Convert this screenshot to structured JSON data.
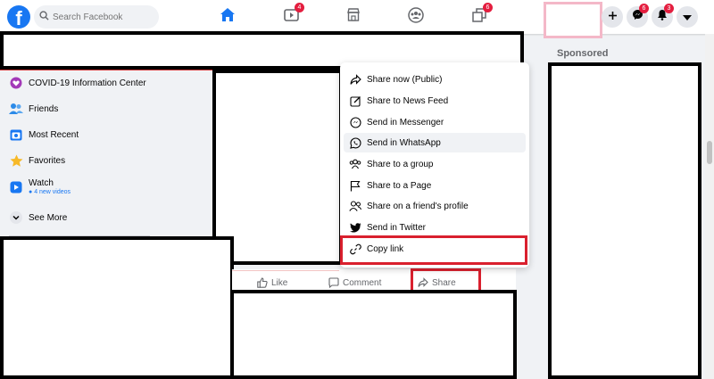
{
  "header": {
    "logo_letter": "f",
    "search_placeholder": "Search Facebook",
    "badges": {
      "watch": "4",
      "groups": "6",
      "messenger": "6",
      "notifications": "3"
    },
    "accent_color": "#1877f2",
    "badge_color": "#e41e3f"
  },
  "sidebar": {
    "items": [
      {
        "label": "COVID-19 Information Center",
        "icon": "covid-heart-icon"
      },
      {
        "label": "Friends",
        "icon": "friends-icon"
      },
      {
        "label": "Most Recent",
        "icon": "most-recent-icon"
      },
      {
        "label": "Favorites",
        "icon": "star-icon"
      },
      {
        "label": "Watch",
        "sub": "4 new videos",
        "icon": "watch-icon"
      },
      {
        "label": "See More",
        "icon": "chevron-down-icon"
      }
    ]
  },
  "share_menu": {
    "items": [
      {
        "label": "Share now (Public)",
        "icon": "share-arrow-icon"
      },
      {
        "label": "Share to News Feed",
        "icon": "edit-icon"
      },
      {
        "label": "Send in Messenger",
        "icon": "messenger-icon"
      },
      {
        "label": "Send in WhatsApp",
        "icon": "whatsapp-icon"
      },
      {
        "label": "Share to a group",
        "icon": "group-icon"
      },
      {
        "label": "Share to a Page",
        "icon": "flag-icon"
      },
      {
        "label": "Share on a friend's profile",
        "icon": "friend-profile-icon"
      },
      {
        "label": "Send in Twitter",
        "icon": "twitter-icon"
      },
      {
        "label": "Copy link",
        "icon": "link-icon"
      }
    ]
  },
  "post_actions": {
    "like": "Like",
    "comment": "Comment",
    "share": "Share"
  },
  "right_column": {
    "sponsored": "Sponsored"
  }
}
